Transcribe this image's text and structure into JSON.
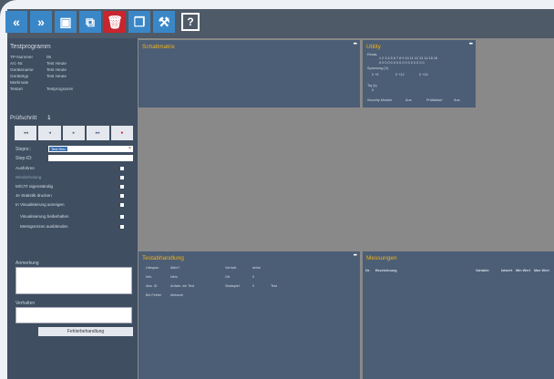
{
  "toolbar": {
    "items": [
      {
        "name": "collapse-left-icon",
        "glyph": "«"
      },
      {
        "name": "expand-right-icon",
        "glyph": "»"
      },
      {
        "name": "save-icon",
        "glyph": "▣"
      },
      {
        "name": "export-icon",
        "glyph": "⧉"
      },
      {
        "name": "delete-icon",
        "glyph": "🗑"
      },
      {
        "name": "windows-icon",
        "glyph": "❐"
      },
      {
        "name": "tools-icon",
        "glyph": "⚒"
      },
      {
        "name": "help-icon",
        "glyph": "?"
      }
    ]
  },
  "sidebar": {
    "title": "Testprogramm",
    "info": [
      {
        "k": "TP-Nummer",
        "v": "05"
      },
      {
        "k": "Art.-Nr.",
        "v": "Test Heute"
      },
      {
        "k": "Gerätename",
        "v": "Test Heute"
      },
      {
        "k": "Gerätetyp",
        "v": "Test Heute"
      },
      {
        "k": "Merkmale",
        "v": ""
      },
      {
        "k": "Testart",
        "v": "Testprogramm"
      }
    ],
    "step_label": "Prüfschritt",
    "step_value": "1",
    "controls": [
      "◂◂",
      "◂",
      "▸",
      "▸▸",
      "●"
    ],
    "stepnr_label": "Stepnr.:",
    "stepnr_value": "Test Heu",
    "step_id_label": "Step-ID:",
    "options": [
      {
        "label": "Ausführen",
        "dim": false,
        "indent": false
      },
      {
        "label": "Wiederholung",
        "dim": true,
        "indent": false
      },
      {
        "label": "M/C/IT eigenständig",
        "dim": false,
        "indent": false
      },
      {
        "label": "Je Statistik drucken",
        "dim": false,
        "indent": false
      },
      {
        "label": "In Visualisierung anzeigen",
        "dim": false,
        "indent": false
      },
      {
        "label": "Visualisierung beibehalten",
        "dim": false,
        "indent": true
      },
      {
        "label": "Messgrenzen ausblenden",
        "dim": false,
        "indent": true
      }
    ],
    "anmerkung_label": "Anmerkung",
    "verhalten_label": "Verhalten",
    "error_button": "Fehlerbehandlung"
  },
  "panels": {
    "schaltmatrix": {
      "title": "Schaltmatrix"
    },
    "utility": {
      "title": "Utility",
      "relais_label": "Relais",
      "relais_row1": "1 2 3 4 5 6 7 8 9 10 11 12 13 14 15 16",
      "relais_row2": "0 0 0 0 0 0 0 0 0 0 0 0 0 0 0 0",
      "spannung_label": "Spannung (V)",
      "spannung_values": [
        "0 +5",
        "0 +12",
        "0 +24"
      ],
      "tiq_label": "Tiq (s)",
      "tiq_value": "0",
      "bottom": [
        "Security Module",
        "Aus",
        "Prüfablauf",
        "Aus"
      ]
    },
    "testabhandlung": {
      "title": "Testabhandlung",
      "rows": [
        [
          "Lifespan",
          "Aktiv?",
          "Verhalt.",
          "keine"
        ],
        [
          "Info",
          "Nein",
          "Ort",
          "0"
        ],
        [
          "Abs. ID",
          "Anfahr. ein Test",
          "Startspiel",
          "0",
          "Test"
        ],
        [
          "Bei Fehler",
          "Abbruch"
        ]
      ]
    },
    "messungen": {
      "title": "Messungen",
      "headers": [
        "Nr.",
        "Bezeichnung",
        "Variable",
        "Istwert",
        "Min Wert",
        "Max Wert"
      ]
    }
  }
}
